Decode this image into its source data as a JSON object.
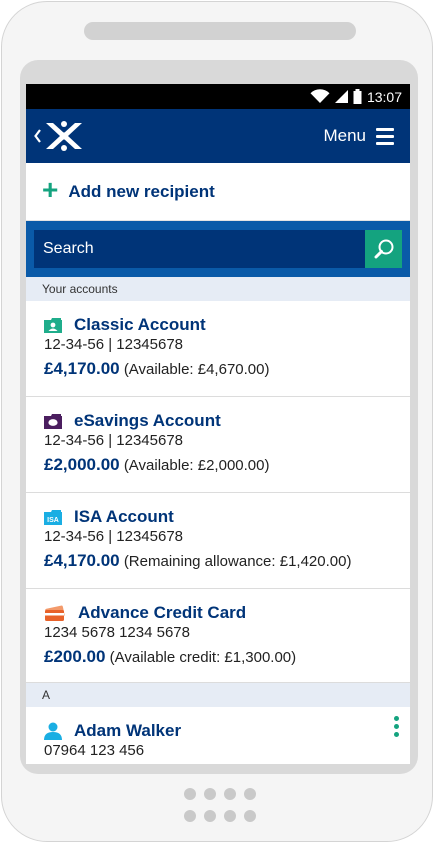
{
  "status_bar": {
    "time": "13:07"
  },
  "header": {
    "menu_label": "Menu"
  },
  "add_recipient": {
    "label": "Add new recipient"
  },
  "search": {
    "placeholder": "Search"
  },
  "sections": {
    "accounts_header": "Your accounts",
    "contacts_header": "A"
  },
  "accounts": [
    {
      "name": "Classic Account",
      "details": "12-34-56 | 12345678",
      "balance": "£4,170.00",
      "note": "(Available: £4,670.00)",
      "icon": "classic-account-icon",
      "icon_color": "#1fad8b"
    },
    {
      "name": "eSavings Account",
      "details": "12-34-56 | 12345678",
      "balance": "£2,000.00",
      "note": "(Available: £2,000.00)",
      "icon": "savings-account-icon",
      "icon_color": "#4b1e5f"
    },
    {
      "name": "ISA Account",
      "details": "12-34-56 | 12345678",
      "balance": "£4,170.00",
      "note": "(Remaining allowance: £1,420.00)",
      "icon": "isa-account-icon",
      "icon_color": "#1aaee3",
      "icon_text": "ISA"
    },
    {
      "name": "Advance Credit Card",
      "details": "1234 5678 1234 5678",
      "balance": "£200.00",
      "note": "(Available credit: £1,300.00)",
      "icon": "credit-card-icon",
      "icon_color": "#e8622a"
    }
  ],
  "contacts": [
    {
      "name": "Adam Walker",
      "phone": "07964 123 456",
      "icon": "person-icon",
      "icon_color": "#1aaee3"
    }
  ],
  "colors": {
    "brand_navy": "#003478",
    "brand_blue": "#0a5aa8",
    "accent_green": "#14a37f",
    "section_bg": "#e6ecf5"
  }
}
